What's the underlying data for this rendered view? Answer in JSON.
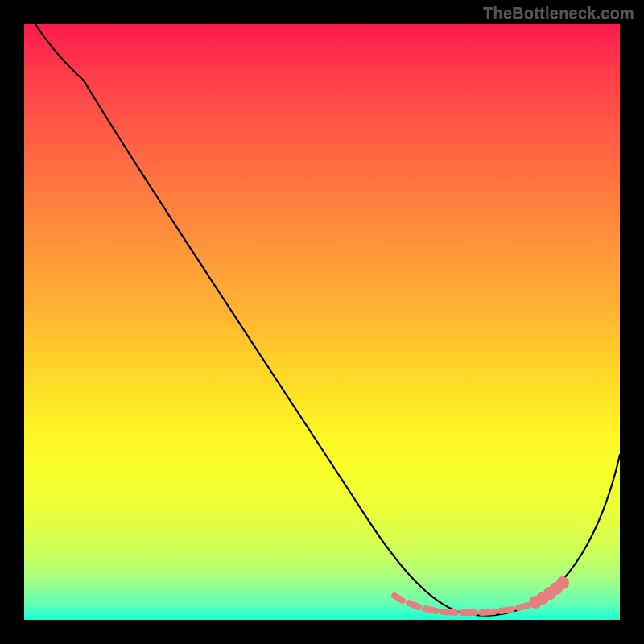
{
  "watermark": "TheBottleneck.com",
  "chart_data": {
    "type": "line",
    "title": "",
    "xlabel": "",
    "ylabel": "",
    "xlim": [
      0,
      100
    ],
    "ylim": [
      0,
      100
    ],
    "grid": false,
    "legend": false,
    "background_gradient": {
      "top": "#ff1a4d",
      "mid": "#ffd62a",
      "bottom": "#1affd6"
    },
    "series": [
      {
        "name": "bottleneck-curve",
        "color": "#000000",
        "x": [
          2,
          5,
          10,
          18,
          26,
          34,
          42,
          50,
          58,
          63,
          67,
          70,
          73,
          77,
          81,
          85,
          88,
          91,
          94,
          97,
          100
        ],
        "y": [
          100,
          97,
          92,
          82,
          71,
          60,
          49,
          38,
          27,
          19,
          12,
          7,
          3,
          1,
          0.5,
          1,
          3,
          7,
          13,
          21,
          30
        ]
      }
    ],
    "markers": [
      {
        "name": "min-band",
        "color": "#e77f7f",
        "shape": "round-segment",
        "x": [
          63,
          66,
          69,
          72,
          75,
          78,
          81,
          84,
          86,
          88,
          90,
          92
        ],
        "y": [
          4.5,
          3.4,
          2.5,
          1.8,
          1.3,
          1.0,
          0.9,
          1.0,
          1.3,
          1.9,
          2.6,
          3.5
        ]
      }
    ]
  }
}
